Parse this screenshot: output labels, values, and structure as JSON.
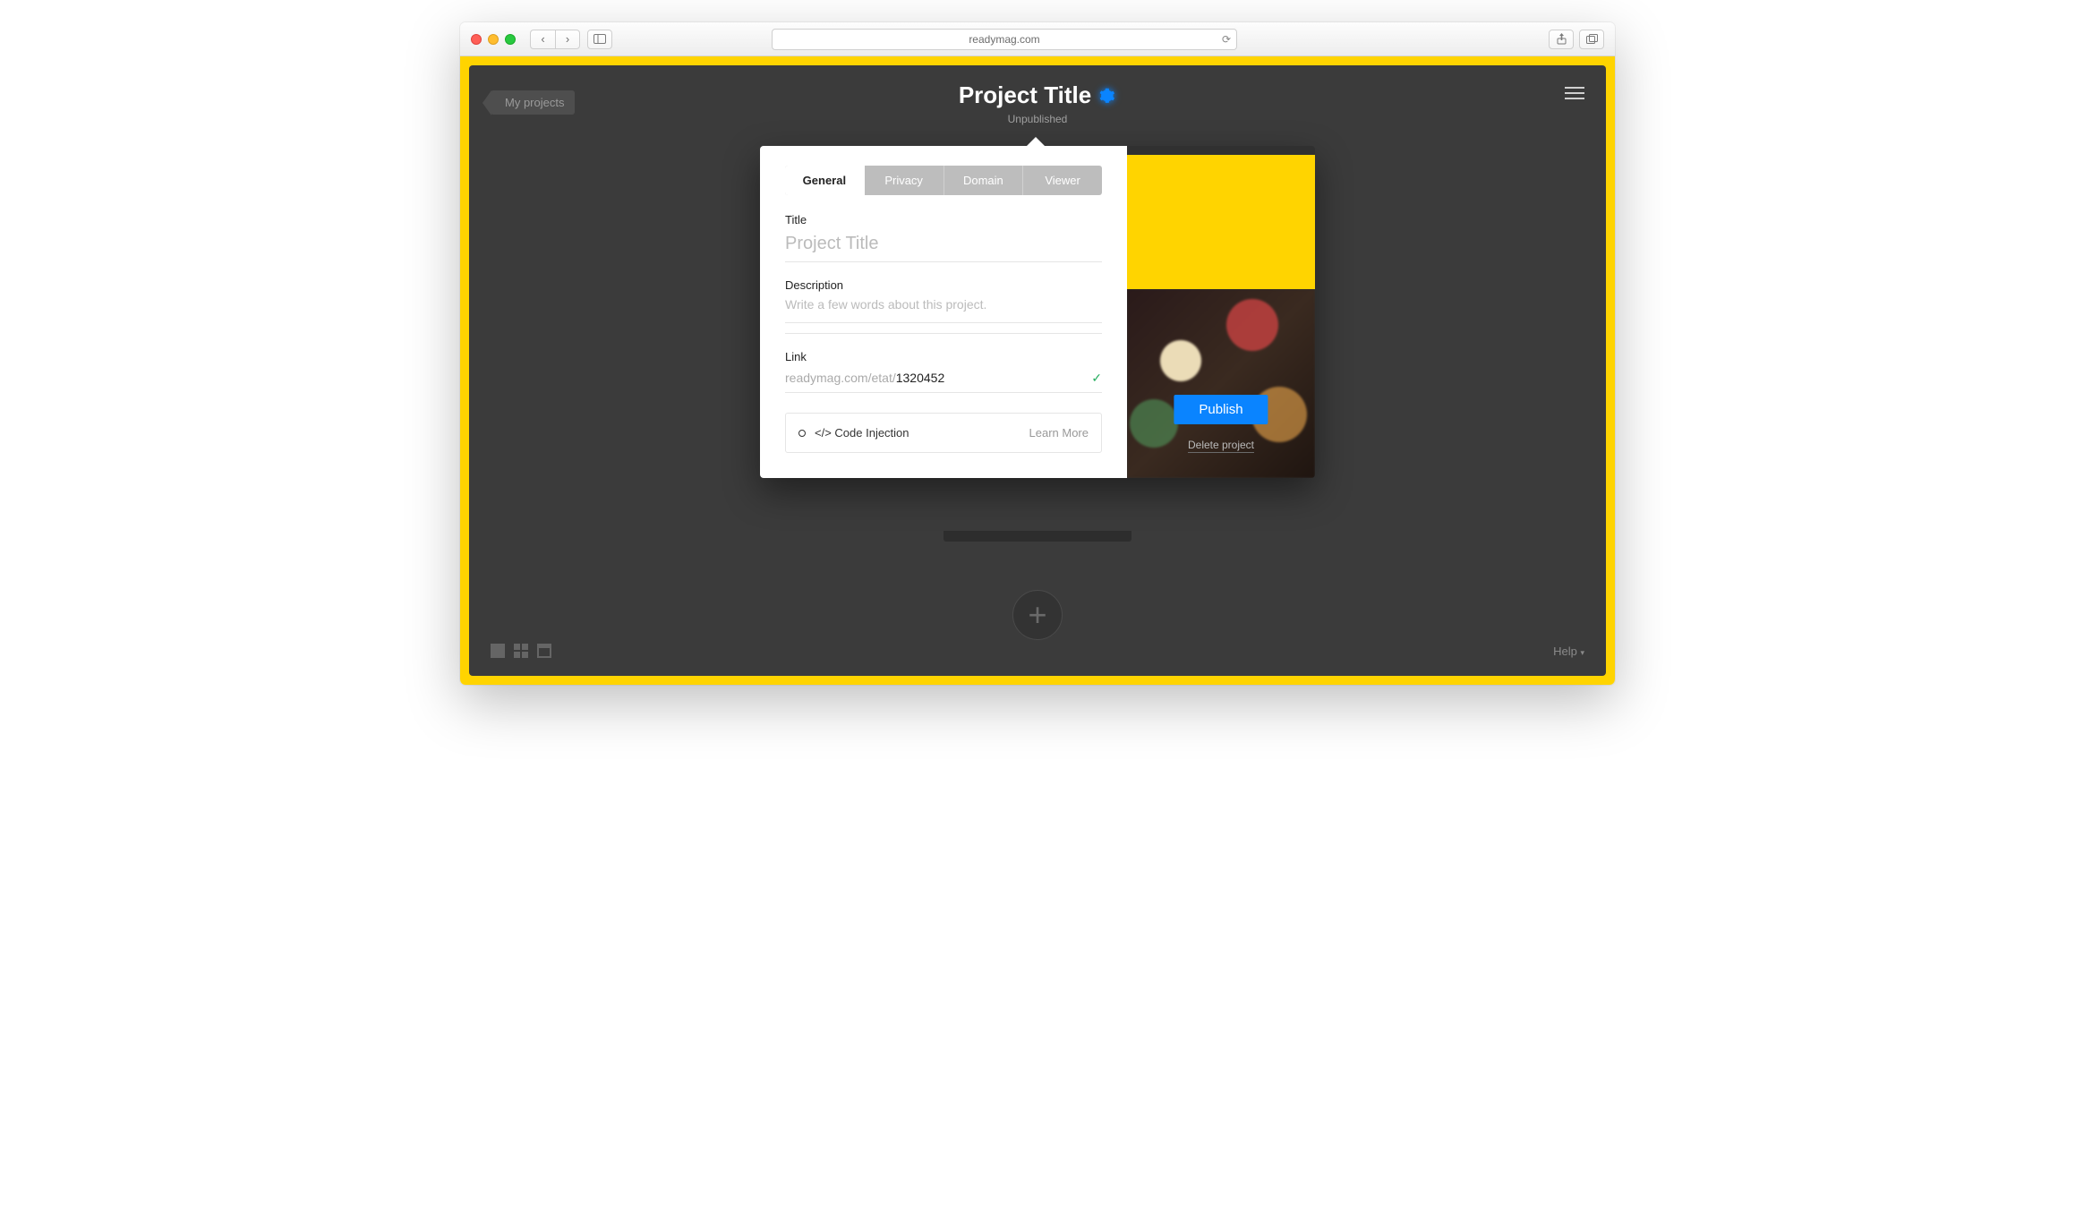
{
  "browser": {
    "url": "readymag.com"
  },
  "header": {
    "back_label": "My projects",
    "title": "Project Title",
    "subtitle": "Unpublished"
  },
  "popover": {
    "tabs": [
      "General",
      "Privacy",
      "Domain",
      "Viewer"
    ],
    "active_tab": "General",
    "title_label": "Title",
    "title_placeholder": "Project Title",
    "title_value": "",
    "description_label": "Description",
    "description_placeholder": "Write a few words about this project.",
    "description_value": "",
    "link_label": "Link",
    "link_prefix": "readymag.com/etat/",
    "link_value": "1320452",
    "code_injection_label": "</>  Code Injection",
    "code_learn_more": "Learn More"
  },
  "right_panel": {
    "publish_label": "Publish",
    "delete_label": "Delete project"
  },
  "footer": {
    "help_label": "Help"
  }
}
